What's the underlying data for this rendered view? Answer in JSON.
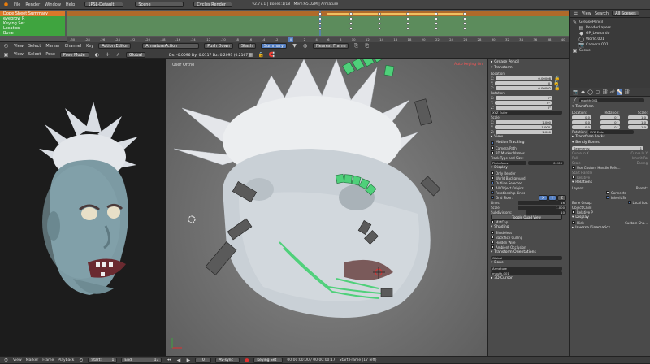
{
  "top_bar": {
    "menus": [
      "File",
      "Render",
      "Window",
      "Help"
    ],
    "layout": "1PSL-Default",
    "scene": "Scene",
    "engine": "Cycles Render",
    "stats": "v2.77.1 | Bones:1/18 | Mem:65.02M | Armature"
  },
  "dopesheet": {
    "channels": [
      {
        "label": "Dope Sheet Summary",
        "color": "#d9782a"
      },
      {
        "label": "eyebrow R",
        "color": "#3fa43f"
      },
      {
        "label": "Keying Set",
        "color": "#3fa43f"
      },
      {
        "label": "Location",
        "color": "#3fa43f"
      },
      {
        "label": "Bone",
        "color": "#3fa43f"
      }
    ],
    "ruler": [
      "-30",
      "-28",
      "-26",
      "-24",
      "-22",
      "-20",
      "-18",
      "-16",
      "-14",
      "-12",
      "-10",
      "-8",
      "-6",
      "-4",
      "-2",
      "0",
      "2",
      "4",
      "6",
      "8",
      "10",
      "12",
      "14",
      "16",
      "18",
      "20",
      "22",
      "24",
      "26",
      "28",
      "30",
      "32",
      "34",
      "36",
      "38",
      "40"
    ],
    "current_frame": "0",
    "header": {
      "menus": [
        "View",
        "Select",
        "Marker",
        "Channel",
        "Key"
      ],
      "mode": "Action Editor",
      "action": "ArmatureAction",
      "push_down": "Push Down",
      "stash": "Stash",
      "summary": "Summary",
      "snap": "Nearest Frame"
    }
  },
  "viewport_header": {
    "menus": [
      "View",
      "Select",
      "Pose"
    ],
    "mode": "Pose Mode",
    "orientation": "Global"
  },
  "viewport": {
    "label": "User Ortho",
    "info": "Dx: -0.0096  Dy: 0.0117  Dz: 0.2093 (0.2167)",
    "auto_key": "Auto Keying On"
  },
  "npanel": {
    "grease_pencil": "Grease Pencil",
    "transform": "Transform",
    "location_label": "Location:",
    "location": [
      "0.00008",
      "0",
      "-0.00002"
    ],
    "rotation_label": "Rotation:",
    "rotation": [
      "0°",
      "0°",
      "0°"
    ],
    "rotation_mode": "XYZ Euler",
    "scale_label": "Scale:",
    "scale": [
      "1.000",
      "1.000",
      "1.000"
    ],
    "view": "View",
    "motion_tracking": "Motion Tracking",
    "camera_path": "Camera Path",
    "markers": "3D Marker Names",
    "track_type": "Track Type and Size:",
    "plain_axes": "Plain Axes",
    "track_size": "0.200",
    "display": "Display",
    "display_items": [
      "Only Render",
      "World Background",
      "Outline Selected",
      "All Object Origins",
      "Relationship Lines"
    ],
    "grid_floor": "Grid Floor:",
    "lines": "Lines:",
    "lines_val": "16",
    "scale_val": "1.000",
    "subdivisions": "Subdivisions:",
    "subdivisions_val": "10",
    "toggle_quad": "Toggle Quad View",
    "matcap": "MatCap",
    "shading": "Shading",
    "shading_items": [
      "Shadeless",
      "Backface Culling",
      "Hidden Wire",
      "Ambient Occlusion"
    ],
    "transform_orient": "Transform Orientations",
    "global": "Global",
    "bone": "Bone",
    "bone_armature": "Armature",
    "bone_name": "mouth.001",
    "cursor_3d": "3D Cursor"
  },
  "outliner": {
    "header": [
      "View",
      "Search",
      "All Scenes"
    ],
    "items": [
      "GreasePencil",
      "RenderLayers",
      "GP_Leonardo",
      "World.001",
      "Camera.001",
      "Scene"
    ]
  },
  "properties": {
    "bone_name": "mouth.001",
    "transform": "Transform",
    "loc_rot_scale": [
      "Location:",
      "Rotation:",
      "Scale:"
    ],
    "values": [
      "0.0",
      "0°",
      "1.0"
    ],
    "rotation_mode_label": "Rotation:",
    "rotation_mode": "XYZ Euler",
    "transform_locks": "Transform Locks",
    "bendy_bones": "Bendy Bones",
    "segments_label": "Segments:",
    "segments": "1",
    "curve_in_x": "Curve In X",
    "curve_in_y": "Curve In Y",
    "roll": "Roll",
    "inherit_roll": "Inherit Ro",
    "scale_label": "Scale",
    "easing": "Easing",
    "use_custom_handle": "Use Custom Handle Refe...",
    "start_handle": "Start Handle",
    "relative": "Relative",
    "relations": "Relations",
    "layers": "Layers:",
    "parent": "Parent:",
    "connected": "Connecte",
    "inherit_sc": "Inherit Sc",
    "local_loc": "Local Loc",
    "bone_group": "Bone Group:",
    "object_child": "Object Child",
    "relative_p": "Relative P",
    "display": "Display",
    "hide": "Hide",
    "custom_shape": "Custom Sha...",
    "inverse_kinematics": "Inverse Kinematics"
  },
  "timeline": {
    "menus": [
      "View",
      "Marker",
      "Frame",
      "Playback"
    ],
    "start": "Start:",
    "start_val": "1",
    "end": "End:",
    "end_val": "17",
    "frame_val": "0",
    "sync": "AV-sync",
    "keying": "Keying Set",
    "time": "00:00:00:00 / 00:00:00:17",
    "start_frame": "Start Frame (17 left)"
  },
  "colors": {
    "accent": "#5680c2",
    "dope_orange": "#d9782a",
    "dope_green": "#3fa43f",
    "bone_green": "#4fd07a"
  }
}
